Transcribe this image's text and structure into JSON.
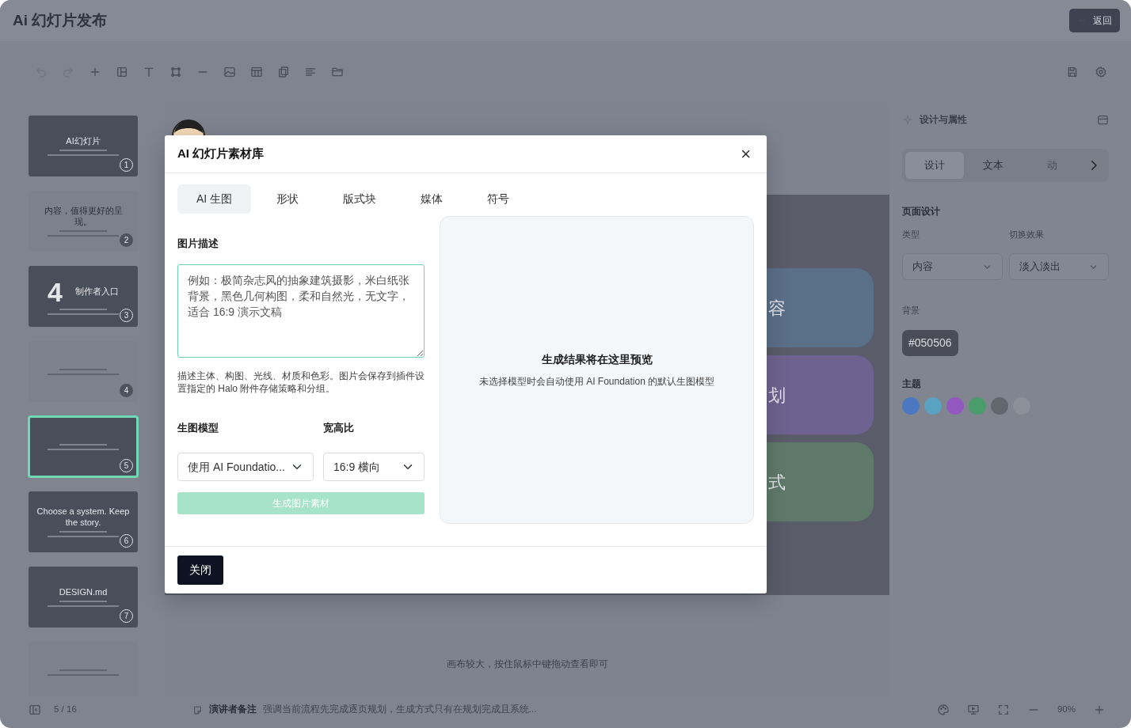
{
  "app": {
    "title": "Ai 幻灯片发布",
    "back_button": "返回"
  },
  "slides": [
    {
      "kind": "dark",
      "number": "1",
      "selected": false,
      "text": "AI幻灯片"
    },
    {
      "kind": "light",
      "number": "2",
      "selected": false,
      "text": "内容，值得更好的呈现。"
    },
    {
      "kind": "dark",
      "number": "3",
      "selected": false,
      "big": "4",
      "text": "制作者入口"
    },
    {
      "kind": "light",
      "number": "4",
      "selected": false
    },
    {
      "kind": "dark",
      "number": "5",
      "selected": true
    },
    {
      "kind": "dark",
      "number": "6",
      "selected": false,
      "text": "Choose a system. Keep the story."
    },
    {
      "kind": "dark",
      "number": "7",
      "selected": false,
      "text": "DESIGN.md"
    },
    {
      "kind": "light",
      "selected": false
    }
  ],
  "canvas": {
    "card_texts": [
      "容",
      "划",
      "式"
    ],
    "hint": "画布较大，按住鼠标中键拖动查看即可"
  },
  "status_bar": {
    "page": "5 / 16",
    "notes_label": "演讲者备注",
    "notes": "强调当前流程先完成逐页规划，生成方式只有在规划完成且系统...",
    "zoom": "90%"
  },
  "properties": {
    "title": "设计与属性",
    "tabs": [
      {
        "label": "设计",
        "selected": true
      },
      {
        "label": "文本",
        "selected": false
      },
      {
        "label": "动",
        "selected": false
      }
    ],
    "section": "页面设计",
    "type_label": "类型",
    "type_value": "内容",
    "transition_label": "切换效果",
    "transition_value": "淡入淡出",
    "background_label": "背景",
    "background_value": "#050506",
    "theme_label": "主题",
    "theme_colors": [
      {
        "color": "#4b78c0"
      },
      {
        "color": "#5aa2c2"
      },
      {
        "color": "#9358bf"
      },
      {
        "color": "#4a9c6a"
      },
      {
        "color": "#64666e"
      },
      {
        "color": "#8c9099"
      }
    ]
  },
  "modal": {
    "title": "AI 幻灯片素材库",
    "close_icon": "×",
    "tabs": [
      {
        "label": "AI 生图",
        "selected": true
      },
      {
        "label": "形状",
        "selected": false
      },
      {
        "label": "版式块",
        "selected": false
      },
      {
        "label": "媒体",
        "selected": false
      },
      {
        "label": "符号",
        "selected": false
      }
    ],
    "description_label": "图片描述",
    "placeholder": "例如：极简杂志风的抽象建筑摄影，米白纸张背景，黑色几何构图，柔和自然光，无文字，适合 16:9 演示文稿",
    "help": "描述主体、构图、光线、材质和色彩。图片会保存到插件设置指定的 Halo 附件存储策略和分组。",
    "model_label": "生图模型",
    "model_value": "使用 AI Foundatio...",
    "ratio_label": "宽高比",
    "ratio_value": "16:9 横向",
    "generate_button": {
      "label": "生成图片素材",
      "disabled": true
    },
    "preview_title": "生成结果将在这里预览",
    "preview_subtitle": "未选择模型时会自动使用 AI Foundation 的默认生图模型",
    "close_button": "关闭"
  }
}
